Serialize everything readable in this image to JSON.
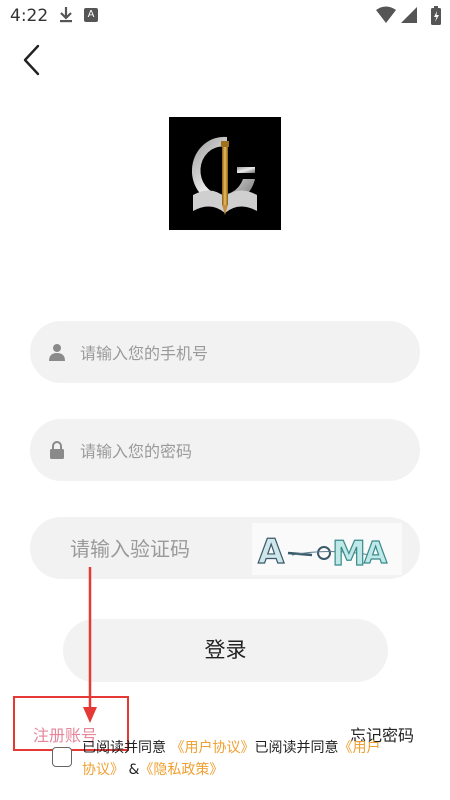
{
  "status_bar": {
    "time": "4:22",
    "icons": [
      "download-icon",
      "a-icon",
      "wifi-icon",
      "signal-icon",
      "battery-icon"
    ]
  },
  "nav": {
    "back_icon": "chevron-left-icon"
  },
  "logo": {
    "icon": "app-logo"
  },
  "form": {
    "phone": {
      "placeholder": "请输入您的手机号",
      "icon": "user-icon"
    },
    "password": {
      "placeholder": "请输入您的密码",
      "icon": "lock-icon"
    },
    "captcha": {
      "placeholder": "请输入验证码",
      "image_text": "A-oMA"
    }
  },
  "login_button": "登录",
  "register_link": "注册账号",
  "forgot_link": "忘记密码",
  "agreement": {
    "prefix": "已阅读并同意",
    "user_agreement": "《用户协议》",
    "middle": "已阅读并同意",
    "privacy_policy": "《隐私政策》",
    "amp": "&"
  },
  "colors": {
    "accent_link": "#f0a030",
    "register": "#e4879a",
    "annotation": "#e53935",
    "field_bg": "#f2f2f2"
  }
}
